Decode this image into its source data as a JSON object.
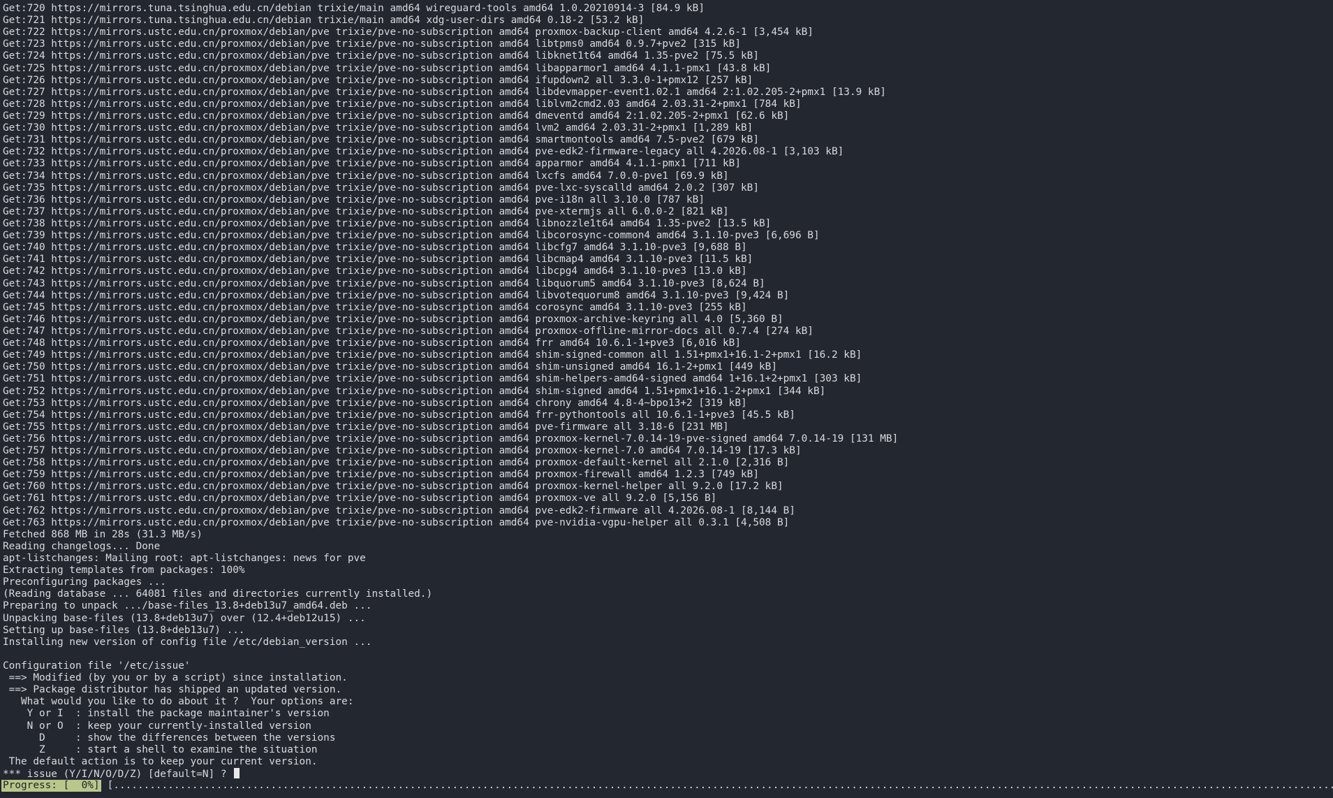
{
  "terminal": {
    "lines": [
      "Get:720 https://mirrors.tuna.tsinghua.edu.cn/debian trixie/main amd64 wireguard-tools amd64 1.0.20210914-3 [84.9 kB]",
      "Get:721 https://mirrors.tuna.tsinghua.edu.cn/debian trixie/main amd64 xdg-user-dirs amd64 0.18-2 [53.2 kB]",
      "Get:722 https://mirrors.ustc.edu.cn/proxmox/debian/pve trixie/pve-no-subscription amd64 proxmox-backup-client amd64 4.2.6-1 [3,454 kB]",
      "Get:723 https://mirrors.ustc.edu.cn/proxmox/debian/pve trixie/pve-no-subscription amd64 libtpms0 amd64 0.9.7+pve2 [315 kB]",
      "Get:724 https://mirrors.ustc.edu.cn/proxmox/debian/pve trixie/pve-no-subscription amd64 libknet1t64 amd64 1.35-pve2 [75.5 kB]",
      "Get:725 https://mirrors.ustc.edu.cn/proxmox/debian/pve trixie/pve-no-subscription amd64 libapparmor1 amd64 4.1.1-pmx1 [43.8 kB]",
      "Get:726 https://mirrors.ustc.edu.cn/proxmox/debian/pve trixie/pve-no-subscription amd64 ifupdown2 all 3.3.0-1+pmx12 [257 kB]",
      "Get:727 https://mirrors.ustc.edu.cn/proxmox/debian/pve trixie/pve-no-subscription amd64 libdevmapper-event1.02.1 amd64 2:1.02.205-2+pmx1 [13.9 kB]",
      "Get:728 https://mirrors.ustc.edu.cn/proxmox/debian/pve trixie/pve-no-subscription amd64 liblvm2cmd2.03 amd64 2.03.31-2+pmx1 [784 kB]",
      "Get:729 https://mirrors.ustc.edu.cn/proxmox/debian/pve trixie/pve-no-subscription amd64 dmeventd amd64 2:1.02.205-2+pmx1 [62.6 kB]",
      "Get:730 https://mirrors.ustc.edu.cn/proxmox/debian/pve trixie/pve-no-subscription amd64 lvm2 amd64 2.03.31-2+pmx1 [1,289 kB]",
      "Get:731 https://mirrors.ustc.edu.cn/proxmox/debian/pve trixie/pve-no-subscription amd64 smartmontools amd64 7.5-pve2 [679 kB]",
      "Get:732 https://mirrors.ustc.edu.cn/proxmox/debian/pve trixie/pve-no-subscription amd64 pve-edk2-firmware-legacy all 4.2026.08-1 [3,103 kB]",
      "Get:733 https://mirrors.ustc.edu.cn/proxmox/debian/pve trixie/pve-no-subscription amd64 apparmor amd64 4.1.1-pmx1 [711 kB]",
      "Get:734 https://mirrors.ustc.edu.cn/proxmox/debian/pve trixie/pve-no-subscription amd64 lxcfs amd64 7.0.0-pve1 [69.9 kB]",
      "Get:735 https://mirrors.ustc.edu.cn/proxmox/debian/pve trixie/pve-no-subscription amd64 pve-lxc-syscalld amd64 2.0.2 [307 kB]",
      "Get:736 https://mirrors.ustc.edu.cn/proxmox/debian/pve trixie/pve-no-subscription amd64 pve-i18n all 3.10.0 [787 kB]",
      "Get:737 https://mirrors.ustc.edu.cn/proxmox/debian/pve trixie/pve-no-subscription amd64 pve-xtermjs all 6.0.0-2 [821 kB]",
      "Get:738 https://mirrors.ustc.edu.cn/proxmox/debian/pve trixie/pve-no-subscription amd64 libnozzle1t64 amd64 1.35-pve2 [13.5 kB]",
      "Get:739 https://mirrors.ustc.edu.cn/proxmox/debian/pve trixie/pve-no-subscription amd64 libcorosync-common4 amd64 3.1.10-pve3 [6,696 B]",
      "Get:740 https://mirrors.ustc.edu.cn/proxmox/debian/pve trixie/pve-no-subscription amd64 libcfg7 amd64 3.1.10-pve3 [9,688 B]",
      "Get:741 https://mirrors.ustc.edu.cn/proxmox/debian/pve trixie/pve-no-subscription amd64 libcmap4 amd64 3.1.10-pve3 [11.5 kB]",
      "Get:742 https://mirrors.ustc.edu.cn/proxmox/debian/pve trixie/pve-no-subscription amd64 libcpg4 amd64 3.1.10-pve3 [13.0 kB]",
      "Get:743 https://mirrors.ustc.edu.cn/proxmox/debian/pve trixie/pve-no-subscription amd64 libquorum5 amd64 3.1.10-pve3 [8,624 B]",
      "Get:744 https://mirrors.ustc.edu.cn/proxmox/debian/pve trixie/pve-no-subscription amd64 libvotequorum8 amd64 3.1.10-pve3 [9,424 B]",
      "Get:745 https://mirrors.ustc.edu.cn/proxmox/debian/pve trixie/pve-no-subscription amd64 corosync amd64 3.1.10-pve3 [255 kB]",
      "Get:746 https://mirrors.ustc.edu.cn/proxmox/debian/pve trixie/pve-no-subscription amd64 proxmox-archive-keyring all 4.0 [5,360 B]",
      "Get:747 https://mirrors.ustc.edu.cn/proxmox/debian/pve trixie/pve-no-subscription amd64 proxmox-offline-mirror-docs all 0.7.4 [274 kB]",
      "Get:748 https://mirrors.ustc.edu.cn/proxmox/debian/pve trixie/pve-no-subscription amd64 frr amd64 10.6.1-1+pve3 [6,016 kB]",
      "Get:749 https://mirrors.ustc.edu.cn/proxmox/debian/pve trixie/pve-no-subscription amd64 shim-signed-common all 1.51+pmx1+16.1-2+pmx1 [16.2 kB]",
      "Get:750 https://mirrors.ustc.edu.cn/proxmox/debian/pve trixie/pve-no-subscription amd64 shim-unsigned amd64 16.1-2+pmx1 [449 kB]",
      "Get:751 https://mirrors.ustc.edu.cn/proxmox/debian/pve trixie/pve-no-subscription amd64 shim-helpers-amd64-signed amd64 1+16.1+2+pmx1 [303 kB]",
      "Get:752 https://mirrors.ustc.edu.cn/proxmox/debian/pve trixie/pve-no-subscription amd64 shim-signed amd64 1.51+pmx1+16.1-2+pmx1 [344 kB]",
      "Get:753 https://mirrors.ustc.edu.cn/proxmox/debian/pve trixie/pve-no-subscription amd64 chrony amd64 4.8-4~bpo13+2 [319 kB]",
      "Get:754 https://mirrors.ustc.edu.cn/proxmox/debian/pve trixie/pve-no-subscription amd64 frr-pythontools all 10.6.1-1+pve3 [45.5 kB]",
      "Get:755 https://mirrors.ustc.edu.cn/proxmox/debian/pve trixie/pve-no-subscription amd64 pve-firmware all 3.18-6 [231 MB]",
      "Get:756 https://mirrors.ustc.edu.cn/proxmox/debian/pve trixie/pve-no-subscription amd64 proxmox-kernel-7.0.14-19-pve-signed amd64 7.0.14-19 [131 MB]",
      "Get:757 https://mirrors.ustc.edu.cn/proxmox/debian/pve trixie/pve-no-subscription amd64 proxmox-kernel-7.0 amd64 7.0.14-19 [17.3 kB]",
      "Get:758 https://mirrors.ustc.edu.cn/proxmox/debian/pve trixie/pve-no-subscription amd64 proxmox-default-kernel all 2.1.0 [2,316 B]",
      "Get:759 https://mirrors.ustc.edu.cn/proxmox/debian/pve trixie/pve-no-subscription amd64 proxmox-firewall amd64 1.2.3 [749 kB]",
      "Get:760 https://mirrors.ustc.edu.cn/proxmox/debian/pve trixie/pve-no-subscription amd64 proxmox-kernel-helper all 9.2.0 [17.2 kB]",
      "Get:761 https://mirrors.ustc.edu.cn/proxmox/debian/pve trixie/pve-no-subscription amd64 proxmox-ve all 9.2.0 [5,156 B]",
      "Get:762 https://mirrors.ustc.edu.cn/proxmox/debian/pve trixie/pve-no-subscription amd64 pve-edk2-firmware all 4.2026.08-1 [8,144 B]",
      "Get:763 https://mirrors.ustc.edu.cn/proxmox/debian/pve trixie/pve-no-subscription amd64 pve-nvidia-vgpu-helper all 0.3.1 [4,508 B]",
      "Fetched 868 MB in 28s (31.3 MB/s)",
      "Reading changelogs... Done",
      "apt-listchanges: Mailing root: apt-listchanges: news for pve",
      "Extracting templates from packages: 100%",
      "Preconfiguring packages ...",
      "(Reading database ... 64081 files and directories currently installed.)",
      "Preparing to unpack .../base-files_13.8+deb13u7_amd64.deb ...",
      "Unpacking base-files (13.8+deb13u7) over (12.4+deb12u15) ...",
      "Setting up base-files (13.8+deb13u7) ...",
      "Installing new version of config file /etc/debian_version ...",
      "",
      "Configuration file '/etc/issue'",
      " ==> Modified (by you or by a script) since installation.",
      " ==> Package distributor has shipped an updated version.",
      "   What would you like to do about it ?  Your options are:",
      "    Y or I  : install the package maintainer's version",
      "    N or O  : keep your currently-installed version",
      "      D     : show the differences between the versions",
      "      Z     : start a shell to examine the situation",
      " The default action is to keep your current version."
    ],
    "prompt": "*** issue (Y/I/N/O/D/Z) [default=N] ? ",
    "progress": {
      "label": "Progress: [  0%]",
      "value_percent": 0,
      "track": "[...................................................................................................................................................................................................................]",
      "badge_color": "#b9c88a"
    },
    "colors": {
      "background": "#23272f",
      "foreground": "#d8dadf"
    }
  }
}
